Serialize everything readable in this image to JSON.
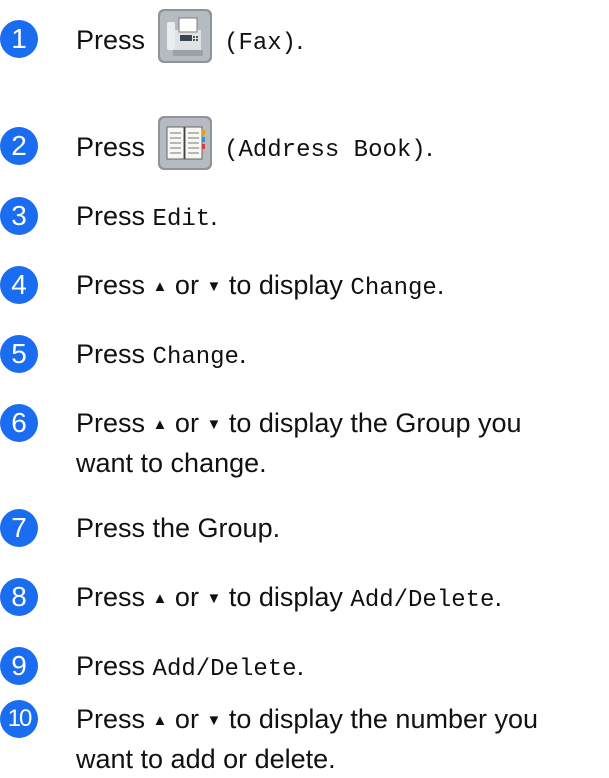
{
  "steps": [
    {
      "number": "1",
      "press": "Press",
      "code": "(Fax)",
      "end": "."
    },
    {
      "number": "2",
      "press": "Press",
      "code": "(Address Book)",
      "end": "."
    },
    {
      "number": "3",
      "press": "Press",
      "code": "Edit",
      "end": "."
    },
    {
      "number": "4",
      "press": "Press",
      "up": "▲",
      "or": "or",
      "down": "▼",
      "to_display": "to display",
      "code": "Change",
      "end": "."
    },
    {
      "number": "5",
      "press": "Press",
      "code": "Change",
      "end": "."
    },
    {
      "number": "6",
      "press": "Press",
      "up": "▲",
      "or": "or",
      "down": "▼",
      "line1_rest": "to display the Group you",
      "line2": "want to change."
    },
    {
      "number": "7",
      "text": "Press the Group."
    },
    {
      "number": "8",
      "press": "Press",
      "up": "▲",
      "or": "or",
      "down": "▼",
      "to_display": "to display",
      "code": "Add/Delete",
      "end": "."
    },
    {
      "number": "9",
      "press": "Press",
      "code": "Add/Delete",
      "end": "."
    },
    {
      "number": "10",
      "press": "Press",
      "up": "▲",
      "or": "or",
      "down": "▼",
      "line1_rest": "to display the number you",
      "line2": "want to add or delete."
    }
  ],
  "icons": {
    "fax": "fax-machine-icon",
    "address_book": "address-book-icon"
  },
  "colors": {
    "badge": "#1a6cf0",
    "text": "#111111"
  }
}
